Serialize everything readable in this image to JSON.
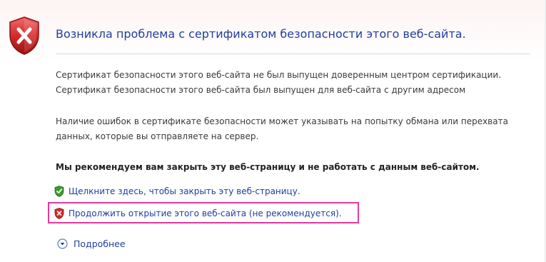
{
  "title": "Возникла проблема с сертификатом безопасности этого веб-сайта.",
  "paragraph1": {
    "line1": "Сертификат безопасности этого веб-сайта не был выпущен доверенным центром сертификации.",
    "line2": "Сертификат безопасности этого веб-сайта был выпущен для веб-сайта с другим адресом"
  },
  "paragraph2": {
    "line1": "Наличие ошибок в сертификате безопасности может указывать на попытку обмана или перехвата",
    "line2": "данных, которые вы отправляете на сервер."
  },
  "recommendation": "Мы рекомендуем вам закрыть эту веб-страницу и не работать с данным веб-сайтом.",
  "links": {
    "close_page": "Щелкните здесь, чтобы закрыть эту веб-страницу.",
    "continue_site": "Продолжить открытие этого веб-сайта (не рекомендуется)."
  },
  "more_info": "Подробнее",
  "icons": {
    "header": "red-shield-x-icon",
    "close_link": "green-shield-check-icon",
    "continue_link": "red-shield-x-icon",
    "more_info": "expand-circle-icon"
  },
  "colors": {
    "link": "#1f3f9e",
    "title": "#1f3f9e",
    "body_text": "#3a3a3a",
    "shield_red": "#c8202a",
    "shield_green": "#3a9a2e",
    "highlight": "#e8389b"
  }
}
